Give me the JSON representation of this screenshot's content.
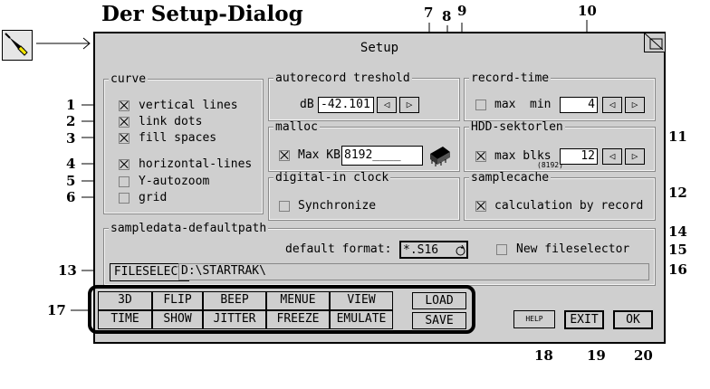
{
  "page_title": "Der Setup-Dialog",
  "dialog": {
    "title": "Setup",
    "curve": {
      "title": "curve",
      "items": [
        {
          "label": "vertical lines",
          "checked": true
        },
        {
          "label": "link dots",
          "checked": true
        },
        {
          "label": "fill spaces",
          "checked": true
        },
        {
          "label": "horizontal-lines",
          "checked": true
        },
        {
          "label": "Y-autozoom",
          "checked": false
        },
        {
          "label": "grid",
          "checked": false
        }
      ]
    },
    "autorecord": {
      "title": "autorecord treshold",
      "unit": "dB",
      "value": "-42.101"
    },
    "malloc": {
      "title": "malloc",
      "label": "Max KB",
      "value": "8192____",
      "checked": true
    },
    "digital_in": {
      "title": "digital-in clock",
      "label": "Synchronize",
      "checked": false
    },
    "record_time": {
      "title": "record-time",
      "max_label": "max",
      "min_label": "min",
      "value": "4",
      "checked": false
    },
    "hdd": {
      "title": "HDD-sektorlen",
      "label": "max blks",
      "value": "12",
      "sub": "(8192)",
      "checked": true
    },
    "samplecache": {
      "title": "samplecache",
      "label": "calculation by record",
      "checked": true
    },
    "sampledata": {
      "title": "sampledata-defaultpath",
      "format_label": "default format:",
      "format_value": "*.S16",
      "new_fileselector": "New fileselector",
      "fileselect_button": "FILESELECT",
      "path": "D:\\STARTRAK\\"
    },
    "toolbar": {
      "top": [
        "3D",
        "FLIP",
        "BEEP",
        "MENUE",
        "VIEW",
        "LOAD"
      ],
      "bottom": [
        "TIME",
        "SHOW",
        "JITTER",
        "FREEZE",
        "EMULATE",
        "SAVE"
      ]
    },
    "help": "HELP",
    "exit": "EXIT",
    "ok": "OK",
    "arrow_left": "◁",
    "arrow_right": "▷"
  },
  "callouts": [
    "1",
    "2",
    "3",
    "4",
    "5",
    "6",
    "7",
    "8",
    "9",
    "10",
    "11",
    "12",
    "13",
    "14",
    "15",
    "16",
    "17",
    "18",
    "19",
    "20"
  ]
}
